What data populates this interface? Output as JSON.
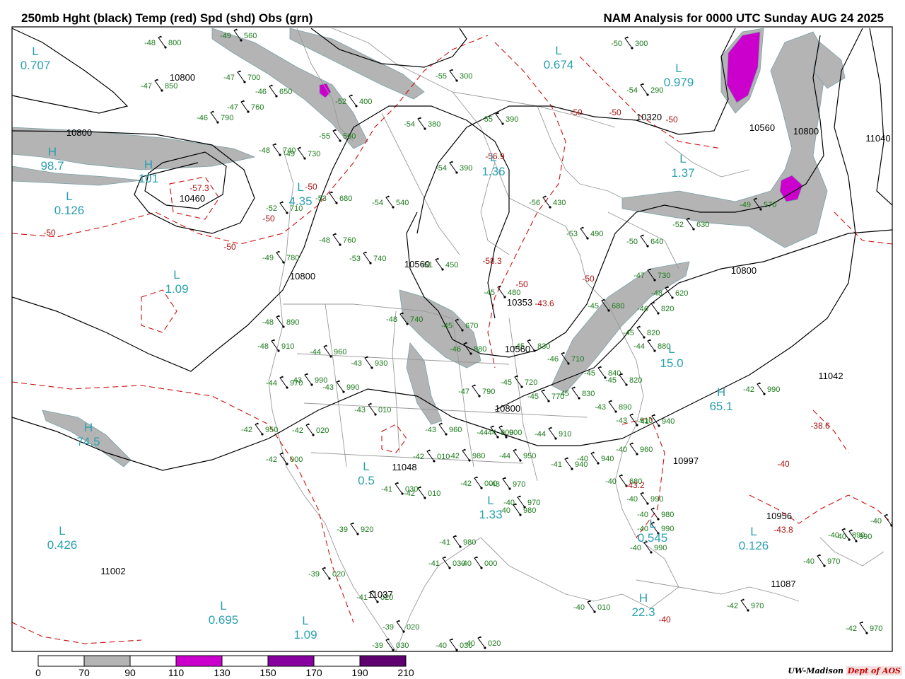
{
  "header": {
    "title_left": "250mb Hght (black) Temp (red) Spd (shd) Obs (grn)",
    "title_right": "NAM Analysis for 0000 UTC Sunday  AUG 24 2025"
  },
  "footer": {
    "credit_org": "UW-Madison",
    "credit_dept": "Dept of AOS"
  },
  "legend": {
    "ticks": [
      "0",
      "70",
      "90",
      "110",
      "130",
      "150",
      "170",
      "190",
      "210"
    ],
    "fills": [
      "#ffffff",
      "#ffffff",
      "#b4b4b4",
      "#ffffff",
      "#cc00cc",
      "#ffffff",
      "#8800a0",
      "#ffffff",
      "#600070"
    ]
  },
  "colors": {
    "height": "#000000",
    "temp": "#cc1111",
    "speed_70_90": "#b4b4b4",
    "speed_110_130": "#cc00cc",
    "obs": "#1a7a1a",
    "centers": "#2aa0b0",
    "coast": "#999999"
  },
  "height_labels": [
    "10800",
    "10800",
    "10460",
    "10560",
    "10800",
    "10353",
    "10560",
    "10800",
    "10320",
    "10560",
    "10800",
    "11040",
    "10800",
    "11042",
    "11048",
    "10997",
    "10956",
    "11002",
    "11037",
    "11087"
  ],
  "temp_labels": [
    "-50",
    "-50",
    "-50",
    "-50",
    "-50",
    "-50",
    "-50",
    "-56.9",
    "-58.3",
    "-50",
    "-57.3",
    "-43.6",
    "-50",
    "-38.6",
    "-40",
    "-43.8",
    "-40",
    "-43.2"
  ],
  "centers": [
    {
      "type": "L",
      "value": "0.707"
    },
    {
      "type": "L",
      "value": "0.674"
    },
    {
      "type": "L",
      "value": "0.979"
    },
    {
      "type": "H",
      "value": "98.7"
    },
    {
      "type": "H",
      "value": "101"
    },
    {
      "type": "L",
      "value": "0.126"
    },
    {
      "type": "L",
      "value": "4.35"
    },
    {
      "type": "L",
      "value": "1.36"
    },
    {
      "type": "L",
      "value": "1.37"
    },
    {
      "type": "L",
      "value": "1.09"
    },
    {
      "type": "H",
      "value": "74.5"
    },
    {
      "type": "L",
      "value": "0.426"
    },
    {
      "type": "L",
      "value": "0.695"
    },
    {
      "type": "L",
      "value": "1.09"
    },
    {
      "type": "H",
      "value": "65.1"
    },
    {
      "type": "L",
      "value": "15.0"
    },
    {
      "type": "L",
      "value": "0.545"
    },
    {
      "type": "L",
      "value": "0.126"
    },
    {
      "type": "H",
      "value": "22.3"
    },
    {
      "type": "L",
      "value": "1.33"
    },
    {
      "type": "L",
      "value": "0.5"
    }
  ],
  "observations": [
    "-48 800",
    "-47 850",
    "-47 700",
    "-46 650",
    "-47 760",
    "-46 790",
    "-49 560",
    "-48 740",
    "-49 730",
    "-52 710",
    "-53 680",
    "-54 540",
    "-55 560",
    "-54 380",
    "-55 390",
    "-55 300",
    "-52 400",
    "-54 390",
    "-56 430",
    "-53 490",
    "-52 630",
    "-54 290",
    "-50 300",
    "-49 570",
    "-50 640",
    "-47 730",
    "-48 620",
    "-48 760",
    "-49 780",
    "-53 740",
    "-51 450",
    "-45 480",
    "-48 740",
    "-45 670",
    "-46 880",
    "-45 830",
    "-46 710",
    "-45 680",
    "-46 820",
    "-45 820",
    "-44 880",
    "-48 890",
    "-48 910",
    "-44 960",
    "-43 990",
    "-44 970",
    "-42 950",
    "-42 020",
    "-42 000",
    "-43 930",
    "-43 990",
    "-43 010",
    "-43 960",
    "-44 900",
    "-44 910",
    "-44 950",
    "-42 010",
    "-42 980",
    "-45 720",
    "-45 770",
    "-45 840",
    "-45 820",
    "-45 830",
    "-43 890",
    "-43 910",
    "-41 940",
    "-40 960",
    "-40 940",
    "-41 940",
    "-40 990",
    "-40 980",
    "-40 990",
    "-40 990",
    "-42 990",
    "-40 970",
    "-40 990",
    "-40 680",
    "-41 030",
    "-42 010",
    "-42 000",
    "-43 970",
    "-40 980",
    "-40 970",
    "-40 990",
    "-39 920",
    "-41 980",
    "-41 030",
    "-40 000",
    "-39 020",
    "-40 010",
    "-39 020",
    "-39 030",
    "-40 030",
    "-40 020",
    "-41 020",
    "-42 970",
    "-42 970",
    "-40 890",
    "-44 900",
    "-47 790"
  ]
}
